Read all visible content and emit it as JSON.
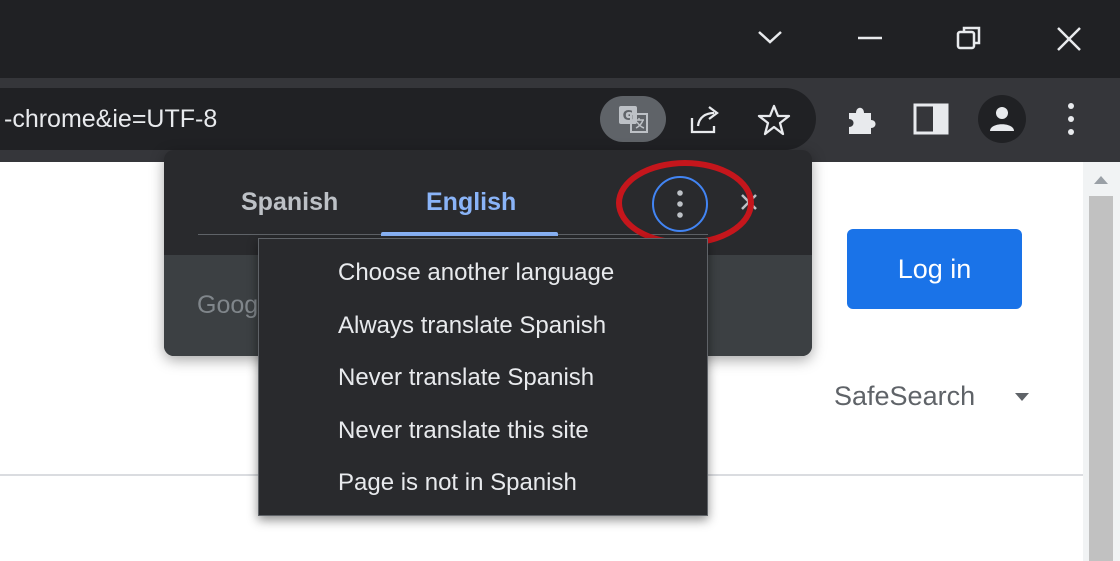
{
  "window_controls": {
    "tab_search_icon": "chevron-down-icon",
    "minimize_icon": "minimize-icon",
    "restore_icon": "restore-icon",
    "close_icon": "close-icon"
  },
  "omnibox": {
    "url_text": "-chrome&ie=UTF-8"
  },
  "toolbar_icons": {
    "translate": "translate-icon",
    "share": "share-icon",
    "bookmark": "star-icon",
    "extensions": "puzzle-icon",
    "side_panel": "side-panel-icon",
    "profile": "profile-icon",
    "menu": "kebab-menu-icon"
  },
  "translate_bubble": {
    "source_language": "Spanish",
    "target_language": "English",
    "google_hint": "Goog",
    "more_button_icon": "vertical-dots-icon",
    "close_icon": "close-icon"
  },
  "options_menu": {
    "items": [
      "Choose another language",
      "Always translate Spanish",
      "Never translate Spanish",
      "Never translate this site",
      "Page is not in Spanish"
    ]
  },
  "page": {
    "login_label": "Log in",
    "safesearch_label": "SafeSearch"
  },
  "colors": {
    "accent_blue": "#8ab4f8",
    "login_blue": "#1a73e8",
    "highlight_red": "#c5161c",
    "dark_surface": "#292a2d"
  }
}
